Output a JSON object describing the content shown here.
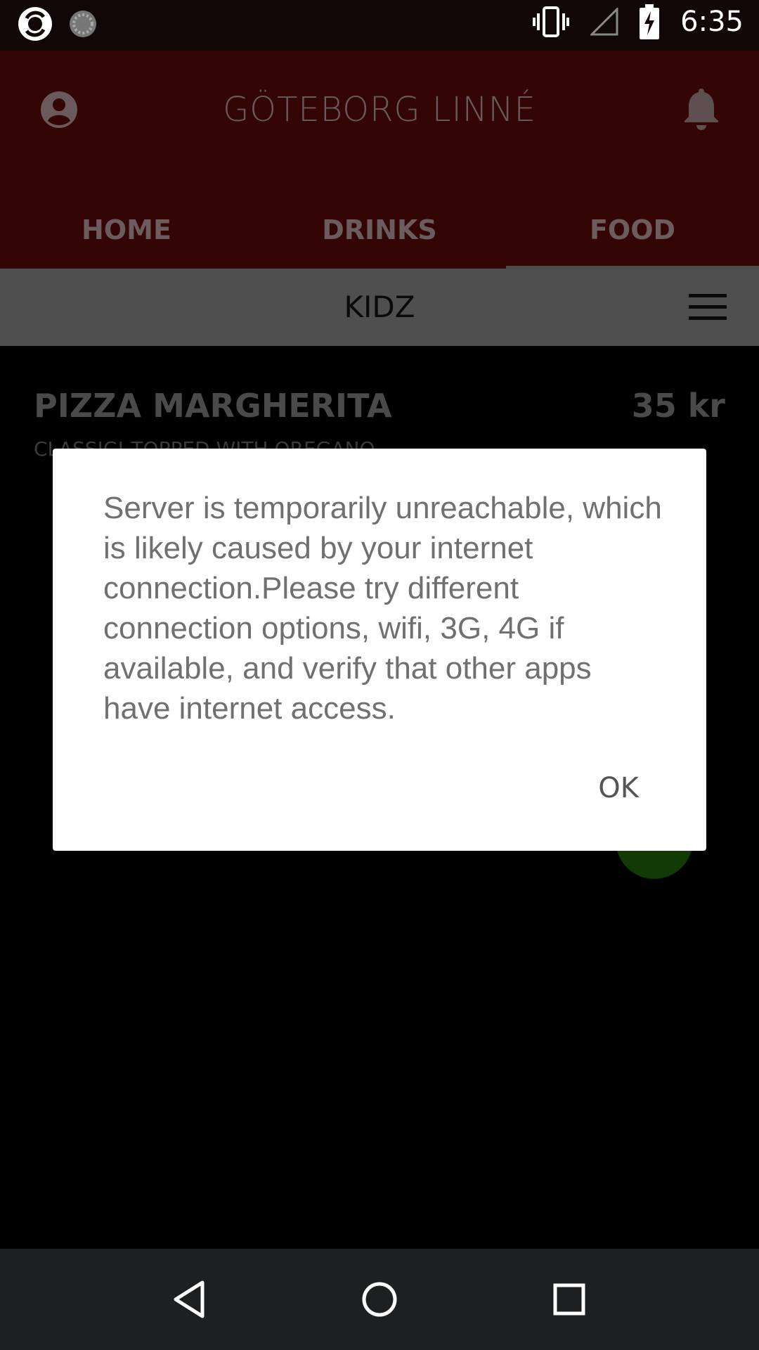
{
  "status_bar": {
    "time": "6:35",
    "icons": [
      "camera-app-icon",
      "loading-icon",
      "vibrate-icon",
      "signal-icon",
      "battery-charging-icon"
    ]
  },
  "app_bar": {
    "title": "GÖTEBORG LINNÉ",
    "profile_icon": "account-icon",
    "notification_icon": "bell-icon"
  },
  "tabs": [
    {
      "label": "HOME"
    },
    {
      "label": "DRINKS"
    },
    {
      "label": "FOOD",
      "selected": true
    }
  ],
  "subbar": {
    "title": "KIDZ",
    "menu_icon": "hamburger-menu-icon"
  },
  "menu_item": {
    "name": "PIZZA MARGHERITA",
    "price": "35 kr",
    "description": "CLASSIC! TOPPED WITH OREGANO"
  },
  "dialog": {
    "message": "Server is temporarily unreachable, which is likely caused by your internet connection.Please try different connection options, wifi, 3G, 4G if available, and verify that other apps have internet access.",
    "ok_label": "OK"
  },
  "nav_bar": {
    "icons": [
      "back-icon",
      "home-icon",
      "recents-icon"
    ]
  },
  "colors": {
    "app_bar": "#340505",
    "subbar": "#4f4f4f",
    "fab": "#123a06",
    "dialog_bg": "#ffffff"
  }
}
